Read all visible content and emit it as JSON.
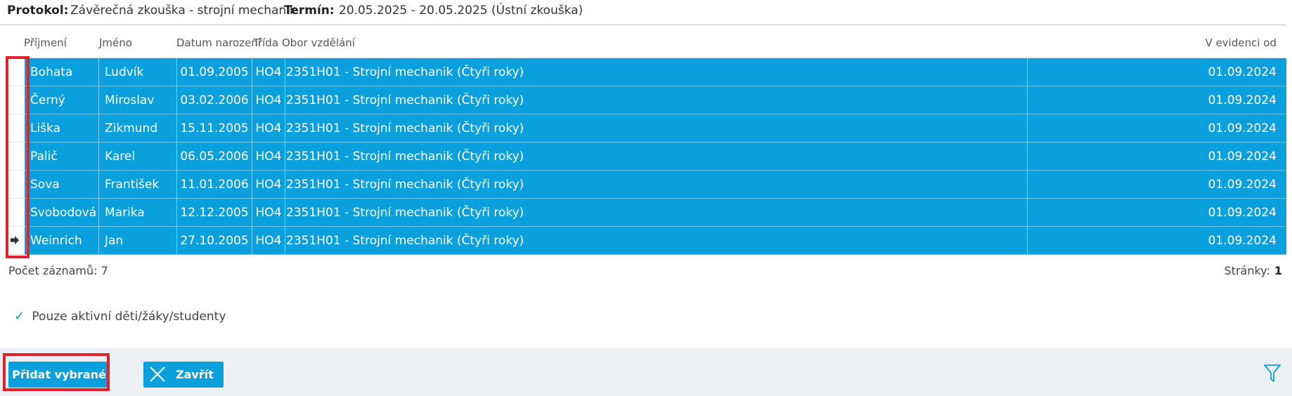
{
  "protocol": {
    "label": "Protokol:",
    "value": "Závěrečná zkouška - strojní mechanik",
    "term_label": "Termín:",
    "term_value": "20.05.2025 - 20.05.2025 (Ústní zkouška)"
  },
  "table": {
    "headers": [
      "Příjmení",
      "Jméno",
      "Datum narození",
      "Třída",
      "Obor vzdělání",
      "V evidenci od"
    ],
    "rows": [
      [
        "Bohata",
        "Ludvík",
        "01.09.2005",
        "HO4",
        "2351H01 - Strojní mechanik (Čtyři roky)",
        "01.09.2024"
      ],
      [
        "Černý",
        "Miroslav",
        "03.02.2006",
        "HO4",
        "2351H01 - Strojní mechanik (Čtyři roky)",
        "01.09.2024"
      ],
      [
        "Liška",
        "Zikmund",
        "15.11.2005",
        "HO4",
        "2351H01 - Strojní mechanik (Čtyři roky)",
        "01.09.2024"
      ],
      [
        "Palič",
        "Karel",
        "06.05.2006",
        "HO4",
        "2351H01 - Strojní mechanik (Čtyři roky)",
        "01.09.2024"
      ],
      [
        "Sova",
        "František",
        "11.01.2006",
        "HO4",
        "2351H01 - Strojní mechanik (Čtyři roky)",
        "01.09.2024"
      ],
      [
        "Svobodová",
        "Marika",
        "12.12.2005",
        "HO4",
        "2351H01 - Strojní mechanik (Čtyři roky)",
        "01.09.2024"
      ],
      [
        "Weinrich",
        "Jan",
        "27.10.2005",
        "HO4",
        "2351H01 - Strojní mechanik (Čtyři roky)",
        "01.09.2024"
      ]
    ],
    "current_row_icon": "arrow-right-icon",
    "selected_row_color": "#0aa0dd",
    "highlight_color": "#e0232a"
  },
  "footer": {
    "count_label": "Počet záznamů: 7",
    "pages_label": "Stránky:",
    "page_number": "1"
  },
  "filter": {
    "label": "Pouze aktivní děti/žáky/studenty",
    "checked": true
  },
  "toolbar": {
    "add_label": "Přidat vybrané",
    "close_label": "Zavřít",
    "filter_icon": "funnel-icon"
  }
}
